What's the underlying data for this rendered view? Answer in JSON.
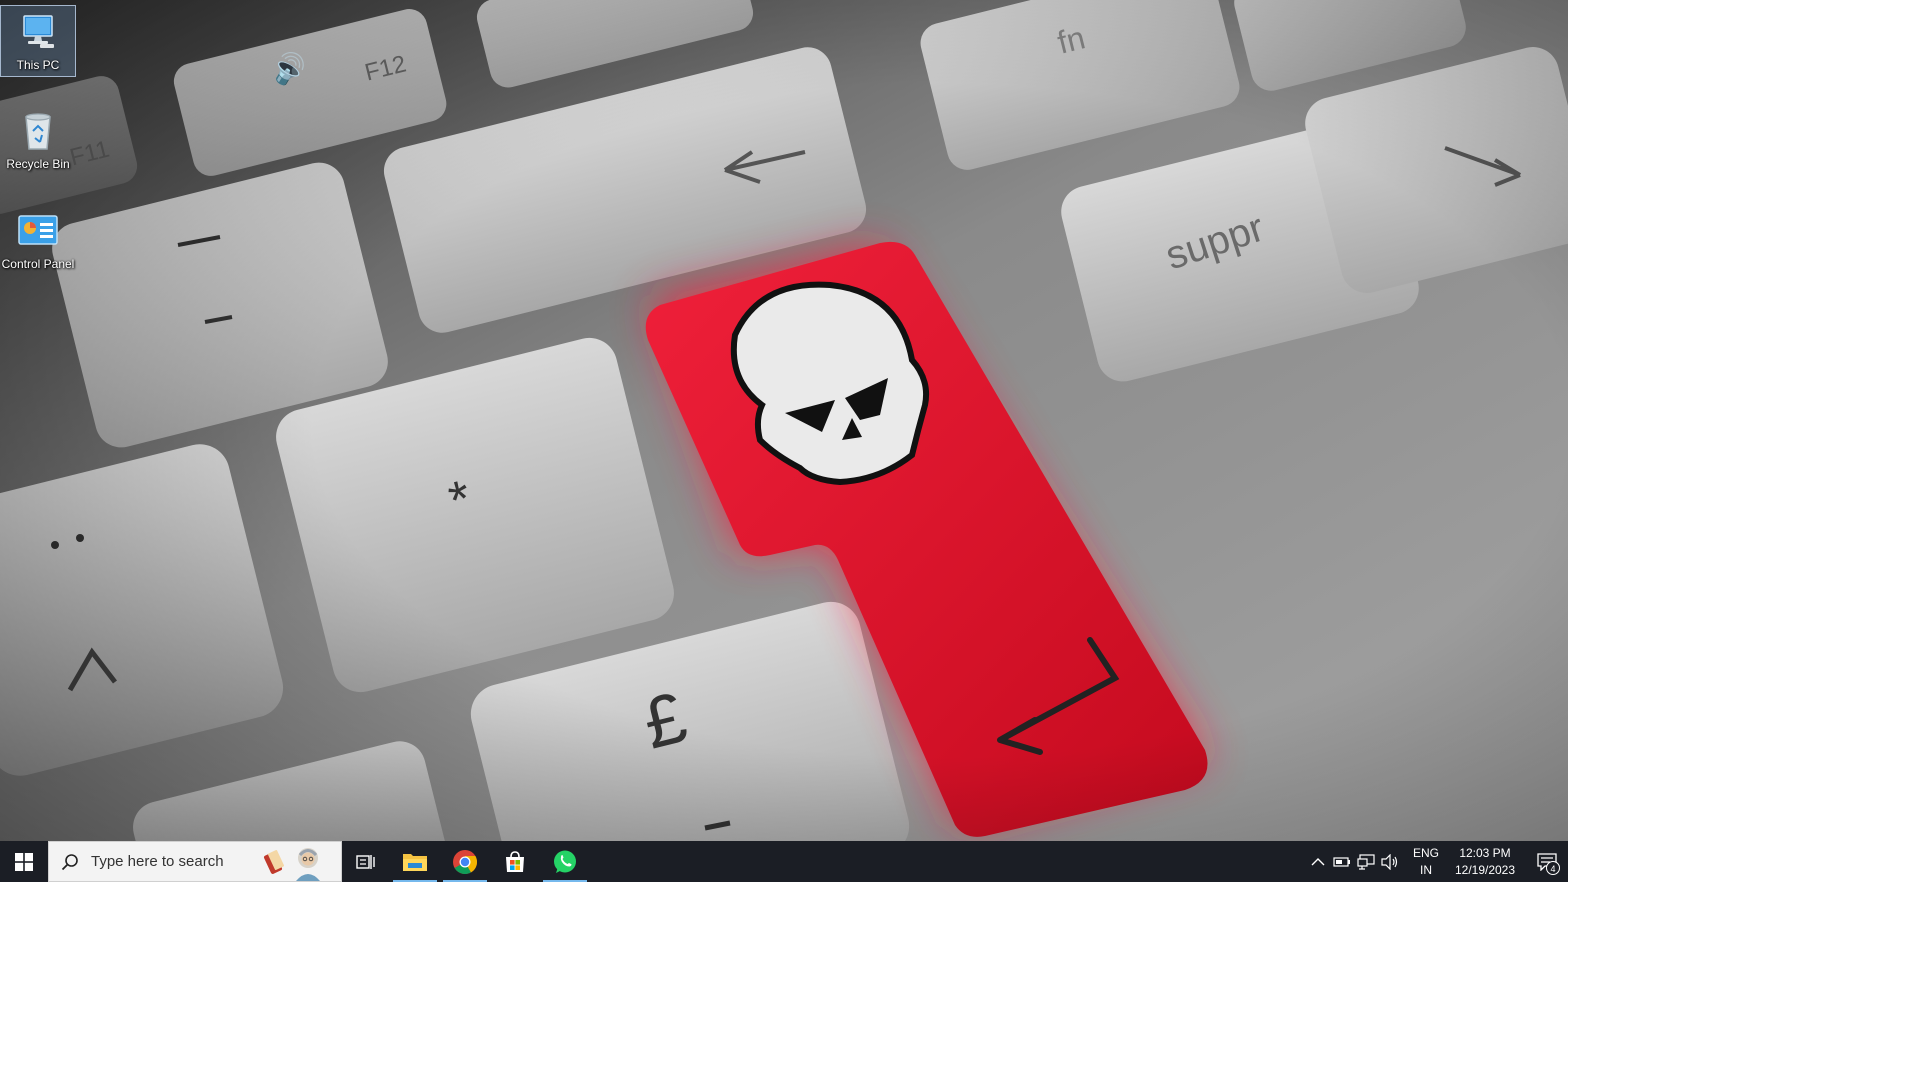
{
  "desktop": {
    "icons": [
      {
        "label": "This PC",
        "icon": "this-pc-icon",
        "selected": true
      },
      {
        "label": "Recycle Bin",
        "icon": "recycle-bin-icon",
        "selected": false
      },
      {
        "label": "Control Panel",
        "icon": "control-panel-icon",
        "selected": false
      }
    ],
    "wallpaper": {
      "keys": {
        "volume_key": "F12",
        "f11_key": "F11",
        "fn_key": "fn",
        "suppr_key": "suppr",
        "asterisk_key": "*",
        "pound_key": "£"
      },
      "enter_key_color": "#e3122a",
      "skull": "skull-icon"
    }
  },
  "taskbar": {
    "search": {
      "placeholder": "Type here to search"
    },
    "pinned_apps": [
      {
        "name": "file-explorer",
        "running": true
      },
      {
        "name": "google-chrome",
        "running": true
      },
      {
        "name": "microsoft-store",
        "running": false
      },
      {
        "name": "whatsapp",
        "running": true
      }
    ],
    "tray": {
      "language_top": "ENG",
      "language_bottom": "IN",
      "time": "12:03 PM",
      "date": "12/19/2023",
      "notification_count": "4"
    },
    "colors": {
      "background": "#1b1e25",
      "accent": "#76b9ed"
    }
  }
}
